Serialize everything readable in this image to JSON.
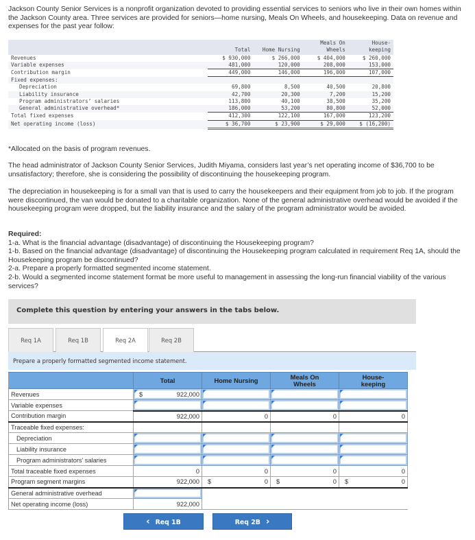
{
  "intro": "Jackson County Senior Services is a nonprofit organization devoted to providing essential services to seniors who live in their own homes within the Jackson County area. Three services are provided for seniors—home nursing, Meals On Wheels, and housekeeping. Data on revenue and expenses for the past year follow:",
  "data_table": {
    "headers": [
      "Total",
      "Home Nursing",
      "Meals On\nWheels",
      "House-\nkeeping"
    ],
    "rows": [
      {
        "label": "Revenues",
        "values": [
          "$ 930,000",
          "$ 266,000",
          "$ 404,000",
          "$ 260,000"
        ]
      },
      {
        "label": "Variable expenses",
        "values": [
          "481,000",
          "120,000",
          "208,000",
          "153,000"
        ]
      },
      {
        "label": "Contribution margin",
        "values": [
          "449,000",
          "146,000",
          "196,000",
          "107,000"
        ]
      },
      {
        "label": "Fixed expenses:",
        "values": [
          "",
          "",
          "",
          ""
        ]
      },
      {
        "label": "Depreciation",
        "values": [
          "69,800",
          "8,500",
          "40,500",
          "20,800"
        ]
      },
      {
        "label": "Liability insurance",
        "values": [
          "42,700",
          "20,300",
          "7,200",
          "15,200"
        ]
      },
      {
        "label": "Program administrators’ salaries",
        "values": [
          "113,800",
          "40,100",
          "38,500",
          "35,200"
        ]
      },
      {
        "label": "General administrative overhead*",
        "values": [
          "186,000",
          "53,200",
          "80,800",
          "52,000"
        ]
      },
      {
        "label": "Total fixed expenses",
        "values": [
          "412,300",
          "122,100",
          "167,000",
          "123,200"
        ]
      },
      {
        "label": "Net operating income (loss)",
        "values": [
          "$ 36,700",
          "$ 23,900",
          "$ 29,000",
          "$ (16,200)"
        ]
      }
    ]
  },
  "footnote": "*Allocated on the basis of program revenues.",
  "para1": "The head administrator of Jackson County Senior Services, Judith Miyama, considers last year’s net operating income of $36,700 to be unsatisfactory; therefore, she is considering the possibility of discontinuing the housekeeping program.",
  "para2": "The depreciation in housekeeping is for a small van that is used to carry the housekeepers and their equipment from job to job. If the program were discontinued, the van would be donated to a charitable organization. None of the general administrative overhead would be avoided if the housekeeping program were dropped, but the liability insurance and the salary of the program administrator would be avoided.",
  "required": {
    "title": "Required:",
    "items": [
      "1-a. What is the financial advantage (disadvantage) of discontinuing the Housekeeping program?",
      "1-b. Based on the financial advantage (disadvantage) of discontinuing the Housekeeping program calculated in requirement Req 1A, should the Housekeeping program be discontinued?",
      "2-a. Prepare a properly formatted segmented income statement.",
      "2-b. Would a segmented income statement format be more useful to management in assessing the long-run financial viability of the various services?"
    ]
  },
  "instruction": "Complete this question by entering your answers in the tabs below.",
  "tabs": [
    "Req 1A",
    "Req 1B",
    "Req 2A",
    "Req 2B"
  ],
  "active_tab": "Req 2A",
  "prompt": "Prepare a properly formatted segmented income statement.",
  "answer_table": {
    "headers": [
      "Total",
      "Home Nursing",
      "Meals On Wheels",
      "House-keeping"
    ],
    "rows": {
      "revenues": {
        "label": "Revenues",
        "currency": "$",
        "values": [
          "922,000",
          "",
          "",
          ""
        ]
      },
      "variable": {
        "label": "Variable expenses",
        "values": [
          "",
          "",
          "",
          ""
        ]
      },
      "cm": {
        "label": "Contribution margin",
        "values": [
          "922,000",
          "0",
          "0",
          "0"
        ]
      },
      "traceable": {
        "label": "Traceable fixed expenses:"
      },
      "depreciation": {
        "label": "Depreciation",
        "values": [
          "",
          "",
          "",
          ""
        ]
      },
      "liability": {
        "label": "Liability insurance",
        "values": [
          "",
          "",
          "",
          ""
        ]
      },
      "salaries": {
        "label": "Program administrators' salaries",
        "values": [
          "",
          "",
          "",
          ""
        ]
      },
      "total_traceable": {
        "label": "Total traceable fixed expenses",
        "values": [
          "0",
          "0",
          "0",
          "0"
        ]
      },
      "segment_margin": {
        "label": "Program segment margins",
        "currency": "$",
        "values": [
          "922,000",
          "0",
          "0",
          "0"
        ]
      },
      "overhead": {
        "label": "General administrative overhead",
        "values": [
          ""
        ]
      },
      "noi": {
        "label": "Net operating income (loss)",
        "values": [
          "922,000"
        ]
      }
    }
  },
  "nav": {
    "prev": "Req 1B",
    "next": "Req 2B"
  },
  "icons": {
    "prev": "‹",
    "next": "›"
  }
}
